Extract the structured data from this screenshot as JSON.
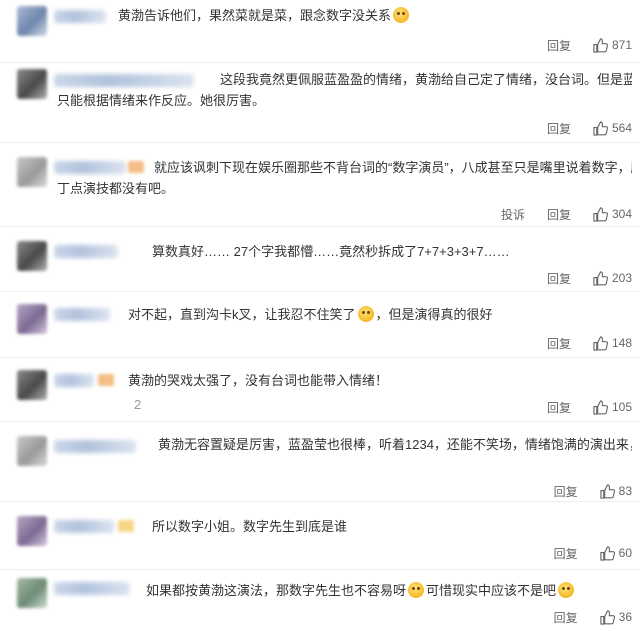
{
  "comments": [
    {
      "text": "黄渤告诉他们，果然菜就是菜，跟念数字没关系",
      "reply_label": "回复",
      "likes": "871"
    },
    {
      "text": "这段我竟然更佩服蓝盈盈的情绪，黄渤给自己定了情绪，没台词。但是蓝盈",
      "text_line2": "只能根据情绪来作反应。她很厉害。",
      "reply_label": "回复",
      "likes": "564"
    },
    {
      "text": "就应该讽刺下现在娱乐圈那些不背台词的“数字演员”，八成甚至只是嘴里说着数字，脸上也",
      "text_line2": "丁点演技都没有吧。",
      "report_label": "投诉",
      "reply_label": "回复",
      "likes": "304"
    },
    {
      "text": "算数真好…… 27个字我都懵……竟然秒拆成了7+7+3+3+7……",
      "reply_label": "回复",
      "likes": "203"
    },
    {
      "text": "对不起，直到沟卡k叉，让我忍不住笑了",
      "text_after": "，但是演得真的很好",
      "reply_label": "回复",
      "likes": "148"
    },
    {
      "text": "黄渤的哭戏太强了，没有台词也能带入情绪！",
      "reply_label": "回复",
      "likes": "105",
      "stray_glyph": "2"
    },
    {
      "text": "黄渤无容置疑是厉害，蓝盈莹也很棒，听着1234，还能不笑场，情绪饱满的演出来，厉害",
      "reply_label": "回复",
      "likes": "83"
    },
    {
      "text": "所以数字小姐。数字先生到底是谁",
      "reply_label": "回复",
      "likes": "60"
    },
    {
      "text": "如果都按黄渤这演法，那数字先生也不容易呀",
      "text_after": "可惜现实中应该不是吧",
      "reply_label": "回复",
      "likes": "36"
    }
  ],
  "icons": {
    "like": "thumbs-up-icon",
    "emoji": "emoji-face-icon"
  },
  "colors": {
    "text": "#333333",
    "meta": "#666666",
    "divider": "#efefef"
  }
}
